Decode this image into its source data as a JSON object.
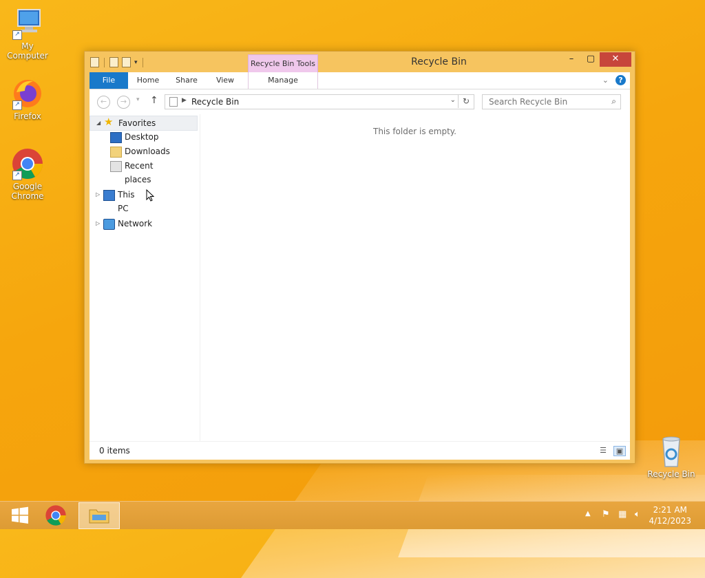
{
  "desktop": {
    "icons": [
      {
        "label": "My Computer"
      },
      {
        "label": "Firefox"
      },
      {
        "label": "Google Chrome"
      },
      {
        "label": "Recycle Bin"
      }
    ]
  },
  "window": {
    "title": "Recycle Bin",
    "contextual_tab": "Recycle Bin Tools",
    "ribbon_tabs": [
      {
        "label": "File"
      },
      {
        "label": "Home"
      },
      {
        "label": "Share"
      },
      {
        "label": "View"
      },
      {
        "label": "Manage"
      }
    ],
    "address": "Recycle Bin",
    "search_placeholder": "Search Recycle Bin",
    "nav": {
      "favorites": "Favorites",
      "favorites_items": [
        {
          "label": "Desktop"
        },
        {
          "label": "Downloads"
        },
        {
          "label": "Recent places"
        }
      ],
      "this_pc": "This PC",
      "network": "Network"
    },
    "empty_message": "This folder is empty.",
    "status": "0 items"
  },
  "taskbar": {
    "time": "2:21 AM",
    "date": "4/12/2023"
  },
  "colors": {
    "desktop": "#f6a60d",
    "window_frame": "#f6c45f",
    "file_tab": "#1979ca",
    "context_tab": "#f0c8ec",
    "close_button": "#c7463b"
  }
}
